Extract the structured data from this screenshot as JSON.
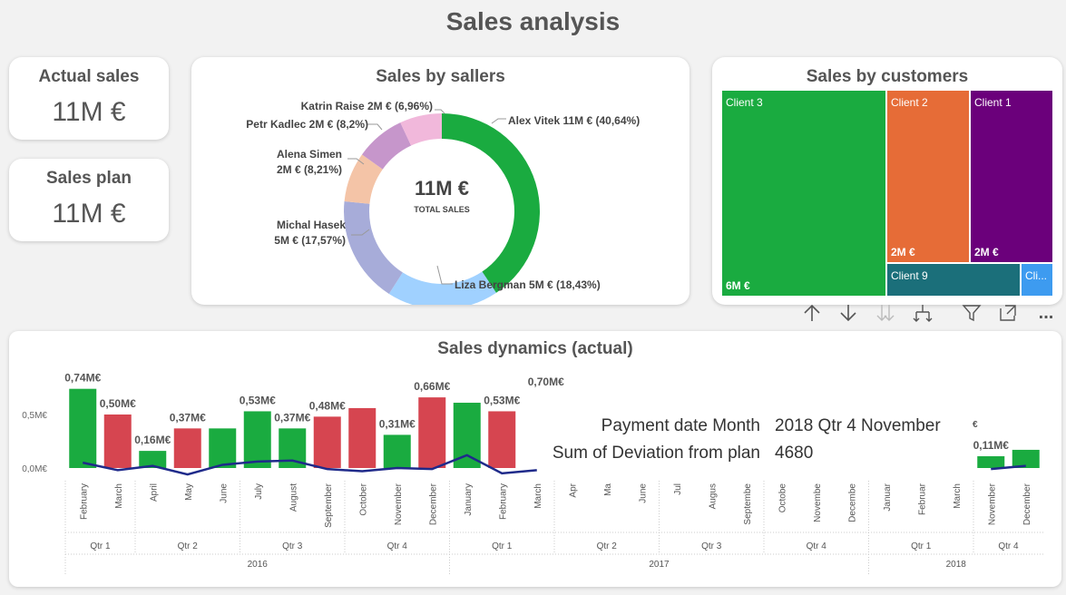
{
  "page_title": "Sales analysis",
  "kpis": {
    "actual": {
      "label": "Actual sales",
      "value": "11M €"
    },
    "plan": {
      "label": "Sales plan",
      "value": "11M €"
    }
  },
  "sellers": {
    "title": "Sales by sallers",
    "center_value": "11M €",
    "center_label": "TOTAL SALES",
    "label_alex": "Alex Vitek 11M € (40,64%)",
    "label_liza": "Liza Bergman 5M € (18,43%)",
    "label_michal_1": "Michal Hasek",
    "label_michal_2": "5M € (17,57%)",
    "label_alena_1": "Alena Simen",
    "label_alena_2": "2M € (8,21%)",
    "label_petr": "Petr Kadlec 2M € (8,2%)",
    "label_katrin": "Katrin Raise 2M € (6,96%)"
  },
  "customers": {
    "title": "Sales by customers",
    "client3": "Client 3",
    "client3_value": "6M €",
    "client2": "Client 2",
    "client2_value": "2M €",
    "client1": "Client 1",
    "client1_value": "2M €",
    "client9": "Client 9",
    "client_cut": "Cli..."
  },
  "toolbar": {
    "drill_up": "up-arrow-icon",
    "drill_down": "down-arrow-icon",
    "expand_next": "double-down-arrow-icon",
    "expand_all": "fork-down-icon",
    "filter": "filter-icon",
    "focus": "focus-mode-icon",
    "more": "..."
  },
  "dynamics": {
    "title": "Sales dynamics (actual)",
    "tooltip_key1": "Payment date Month",
    "tooltip_val1": "2018 Qtr 4 November",
    "tooltip_key2": "Sum of Deviation from plan",
    "tooltip_val2": "4680"
  },
  "colors": {
    "green": "#1aab40",
    "red": "#d64550",
    "line": "#1f2a8a",
    "orange": "#e66c37",
    "purple": "#6b007b",
    "teal": "#1b6f7a",
    "blue": "#3d9bf0",
    "light_blue": "#a0d1ff",
    "lavender": "#a7acd9",
    "peach": "#f4c4a7",
    "mauve": "#c696cb",
    "pink": "#f1b8db"
  },
  "chart_data": {
    "type": "bar",
    "y_ticks": [
      "0,5M€",
      "0,0M€"
    ],
    "months": [
      {
        "label": "February",
        "value": 0.74,
        "value_label": "0,74M€",
        "color": "green",
        "line": 0.05
      },
      {
        "label": "March",
        "value": 0.5,
        "value_label": "0,50M€",
        "color": "red",
        "line": -0.02
      },
      {
        "label": "April",
        "value": 0.16,
        "value_label": "0,16M€",
        "color": "green",
        "line": 0.02
      },
      {
        "label": "May",
        "value": 0.37,
        "value_label": "0,37M€",
        "color": "red",
        "line": -0.06
      },
      {
        "label": "June",
        "value": 0.37,
        "value_label": "",
        "color": "green",
        "line": 0.03
      },
      {
        "label": "July",
        "value": 0.53,
        "value_label": "0,53M€",
        "color": "green",
        "line": 0.06
      },
      {
        "label": "August",
        "value": 0.37,
        "value_label": "0,37M€",
        "color": "green",
        "line": 0.07
      },
      {
        "label": "September",
        "value": 0.48,
        "value_label": "0,48M€",
        "color": "red",
        "line": -0.01
      },
      {
        "label": "October",
        "value": 0.56,
        "value_label": "",
        "color": "red",
        "line": -0.03
      },
      {
        "label": "November",
        "value": 0.31,
        "value_label": "0,31M€",
        "color": "green",
        "line": 0.0
      },
      {
        "label": "December",
        "value": 0.66,
        "value_label": "0,66M€",
        "color": "red",
        "line": -0.01
      },
      {
        "label": "January",
        "value": 0.61,
        "value_label": "",
        "color": "green",
        "line": 0.12
      },
      {
        "label": "February",
        "value": 0.53,
        "value_label": "0,53M€",
        "color": "red",
        "line": -0.05
      },
      {
        "label": "March",
        "value": null,
        "value_label": "0,70M€",
        "color": "green",
        "line": -0.02
      },
      {
        "label": "Apr",
        "value": null,
        "value_label": "",
        "color": "green",
        "line": null
      },
      {
        "label": "Ma",
        "value": null,
        "value_label": "",
        "color": "green",
        "line": null
      },
      {
        "label": "June",
        "value": null,
        "value_label": "",
        "color": "green",
        "line": null
      },
      {
        "label": "Jul",
        "value": null,
        "value_label": "",
        "color": "green",
        "line": null
      },
      {
        "label": "Augus",
        "value": null,
        "value_label": "",
        "color": "green",
        "line": null
      },
      {
        "label": "Septembe",
        "value": null,
        "value_label": "",
        "color": "green",
        "line": null
      },
      {
        "label": "Octobe",
        "value": null,
        "value_label": "",
        "color": "green",
        "line": null
      },
      {
        "label": "Novembe",
        "value": null,
        "value_label": "",
        "color": "green",
        "line": null
      },
      {
        "label": "Decembe",
        "value": null,
        "value_label": "",
        "color": "green",
        "line": null
      },
      {
        "label": "Januar",
        "value": null,
        "value_label": "",
        "color": "green",
        "line": null
      },
      {
        "label": "Februar",
        "value": null,
        "value_label": "",
        "color": "green",
        "line": null
      },
      {
        "label": "March",
        "value": null,
        "value_label": "",
        "color": "green",
        "line": null
      },
      {
        "label": "November",
        "value": 0.11,
        "value_label": "0,11M€",
        "color": "green",
        "line": -0.01
      },
      {
        "label": "December",
        "value": 0.17,
        "value_label": "",
        "color": "green",
        "line": 0.02
      }
    ],
    "quarters": [
      {
        "label": "Qtr 1",
        "span": 2
      },
      {
        "label": "Qtr 2",
        "span": 3
      },
      {
        "label": "Qtr 3",
        "span": 3
      },
      {
        "label": "Qtr 4",
        "span": 3
      },
      {
        "label": "Qtr 1",
        "span": 3
      },
      {
        "label": "Qtr 2",
        "span": 3
      },
      {
        "label": "Qtr 3",
        "span": 3
      },
      {
        "label": "Qtr 4",
        "span": 3
      },
      {
        "label": "Qtr 1",
        "span": 3
      },
      {
        "label": "Qtr 4",
        "span": 2
      }
    ],
    "years": [
      {
        "label": "2016",
        "span": 11
      },
      {
        "label": "2017",
        "span": 12
      },
      {
        "label": "2018",
        "span": 5
      }
    ],
    "stray_label": "€"
  }
}
